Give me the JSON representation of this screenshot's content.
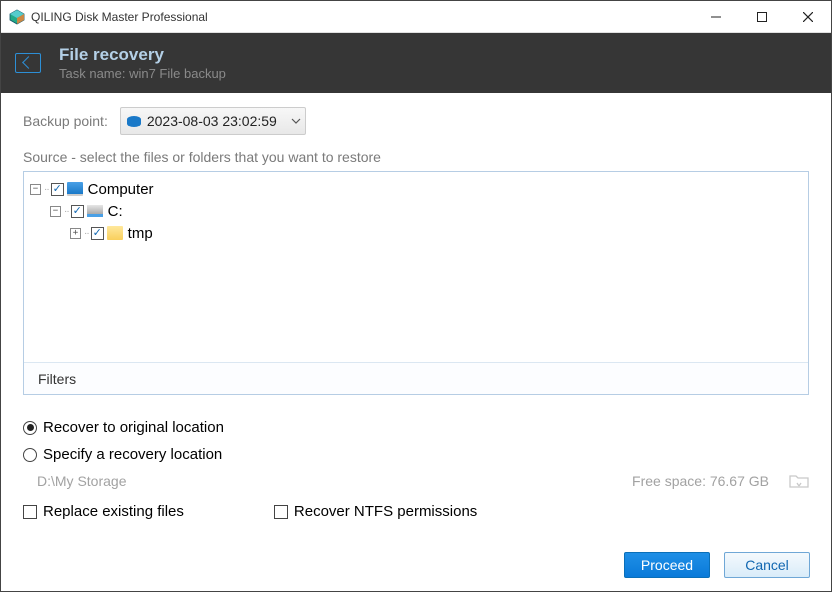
{
  "window": {
    "title": "QILING Disk Master Professional"
  },
  "header": {
    "title": "File recovery",
    "subtitle": "Task name: win7 File backup"
  },
  "backup": {
    "label": "Backup point:",
    "selected": "2023-08-03 23:02:59"
  },
  "source_label": "Source - select the files or folders that you want to restore",
  "tree": {
    "computer": {
      "label": "Computer",
      "checked": true,
      "expanded": true
    },
    "drive": {
      "label": "C:",
      "checked": true,
      "expanded": true
    },
    "folder": {
      "label": "tmp",
      "checked": true,
      "expanded": false
    }
  },
  "filters": {
    "label": "Filters"
  },
  "recovery": {
    "original_label": "Recover to original location",
    "specify_label": "Specify a recovery location",
    "selected": "original",
    "path": "D:\\My Storage",
    "free_space": "Free space: 76.67 GB"
  },
  "options": {
    "replace_label": "Replace existing files",
    "replace_checked": false,
    "ntfs_label": "Recover NTFS permissions",
    "ntfs_checked": false
  },
  "buttons": {
    "proceed": "Proceed",
    "cancel": "Cancel"
  }
}
